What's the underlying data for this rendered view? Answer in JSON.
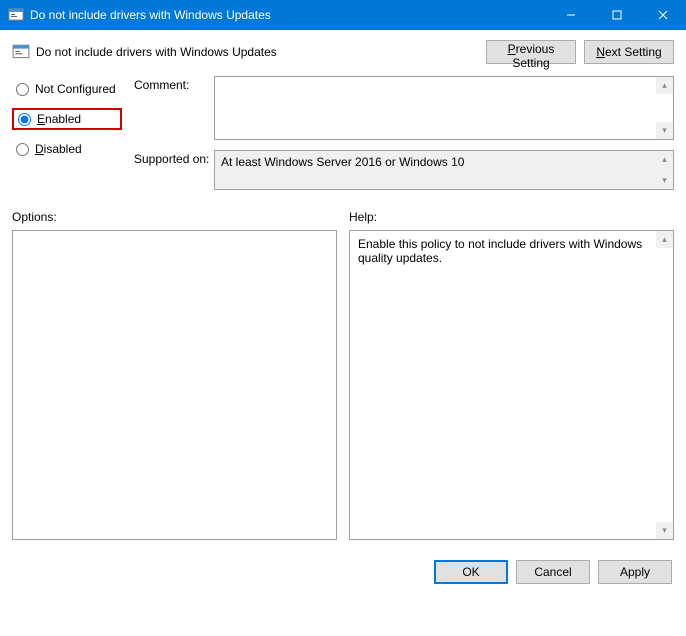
{
  "titlebar": {
    "title": "Do not include drivers with Windows Updates"
  },
  "header": {
    "policy_title": "Do not include drivers with Windows Updates",
    "prev_btn": "Previous Setting",
    "next_btn": "Next Setting"
  },
  "radios": {
    "not_configured": "Not Configured",
    "enabled": "Enabled",
    "disabled": "Disabled",
    "selected": "enabled"
  },
  "fields": {
    "comment_label": "Comment:",
    "comment_value": "",
    "supported_label": "Supported on:",
    "supported_value": "At least Windows Server 2016 or Windows 10"
  },
  "lower": {
    "options_label": "Options:",
    "help_label": "Help:",
    "help_text": "Enable this policy to not include drivers with Windows quality updates."
  },
  "footer": {
    "ok": "OK",
    "cancel": "Cancel",
    "apply": "Apply"
  }
}
